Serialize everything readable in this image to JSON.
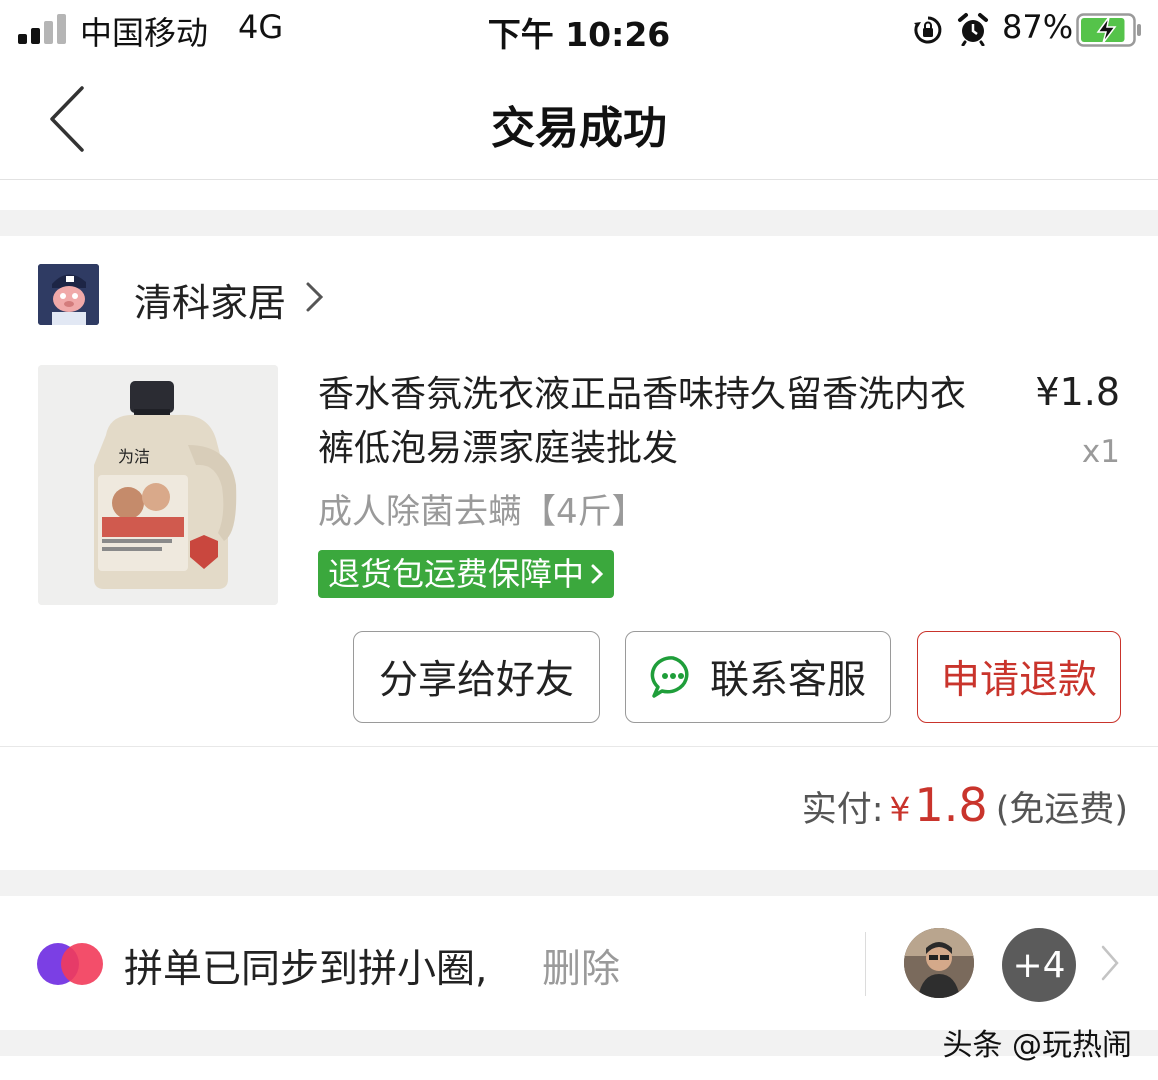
{
  "status_bar": {
    "carrier": "中国移动",
    "network": "4G",
    "time": "下午 10:26",
    "battery_percent": "87%",
    "battery_level": 0.87,
    "icons": [
      "signal-icon",
      "orientation-lock-icon",
      "alarm-icon",
      "battery-charging-icon"
    ]
  },
  "nav": {
    "title": "交易成功",
    "back_icon": "chevron-left-icon"
  },
  "shop": {
    "name": "清科家居",
    "chevron_icon": "chevron-right-icon"
  },
  "product": {
    "title": "香水香氛洗衣液正品香味持久留香洗内衣裤低泡易漂家庭装批发",
    "price": "¥1.8",
    "quantity": "x1",
    "spec": "成人除菌去螨【4斤】",
    "guarantee": "退货包运费保障中",
    "guarantee_color": "#3ba83d"
  },
  "actions": {
    "share": "分享给好友",
    "service": "联系客服",
    "refund": "申请退款",
    "refund_color": "#c9342c"
  },
  "total": {
    "label": "实付:",
    "currency": "¥",
    "amount": "1.8",
    "note": "(免运费)"
  },
  "circle": {
    "text": "拼单已同步到拼小圈,",
    "delete": "删除",
    "extra_members": "+4"
  },
  "watermark": "头条 @玩热闹"
}
